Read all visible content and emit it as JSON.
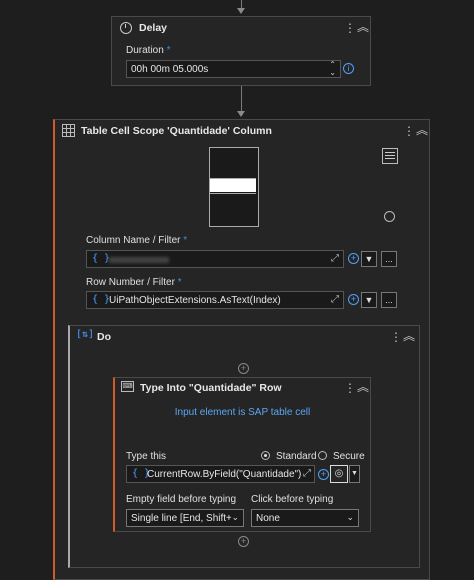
{
  "delay": {
    "title": "Delay",
    "duration_label": "Duration",
    "duration_required": "*",
    "duration_value": "00h 00m 05.000s"
  },
  "table_cell_scope": {
    "title": "Table Cell Scope 'Quantidade' Column",
    "column_label": "Column Name / Filter",
    "column_required": "*",
    "column_value": "",
    "row_label": "Row Number / Filter",
    "row_required": "*",
    "row_value": "UiPathObjectExtensions.AsText(Index)",
    "more_button": "..."
  },
  "do_block": {
    "title": "Do"
  },
  "type_into": {
    "title": "Type Into \"Quantidade\" Row",
    "target_message": "Input element is SAP table cell",
    "type_this_label": "Type this",
    "mode_standard": "Standard",
    "mode_secure": "Secure",
    "type_this_value": "CurrentRow.ByField(\"Quantidade\")",
    "empty_field_label": "Empty field before typing",
    "empty_field_value": "Single line [End, Shift+H",
    "click_before_label": "Click before typing",
    "click_before_value": "None"
  },
  "icons": {
    "kebab": "⋮",
    "collapse": "︽",
    "brace": "{ }",
    "plus": "+",
    "caret": "⌄",
    "info": "i",
    "expand": "⤢"
  },
  "colors": {
    "background": "#1e1e1e",
    "card": "#252526",
    "accent_orange": "#d05a2a",
    "accent_blue": "#4ea1ff"
  }
}
